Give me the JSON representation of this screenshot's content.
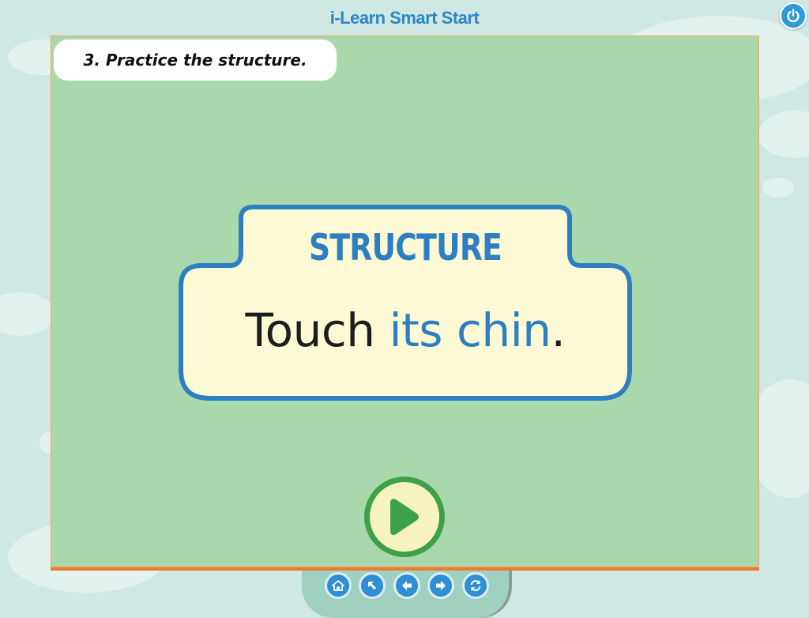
{
  "app": {
    "title": "i-Learn Smart Start"
  },
  "header": {
    "power_icon": "power-icon"
  },
  "activity": {
    "instruction": "3. Practice the structure.",
    "heading": "STRUCTURE",
    "sentence": {
      "part1": "Touch ",
      "highlight": "its chin",
      "part2": "."
    },
    "play_icon": "play-icon"
  },
  "nav": {
    "buttons": [
      "home-icon",
      "back-arrow-icon",
      "previous-icon",
      "next-icon",
      "refresh-icon"
    ]
  },
  "colors": {
    "background": "#cfe8e4",
    "stage": "#aad8ad",
    "accent_blue": "#2d7fc1",
    "card_fill": "#fcf9d4",
    "play_green": "#3ea14a",
    "stage_border": "#ed7b2f"
  }
}
